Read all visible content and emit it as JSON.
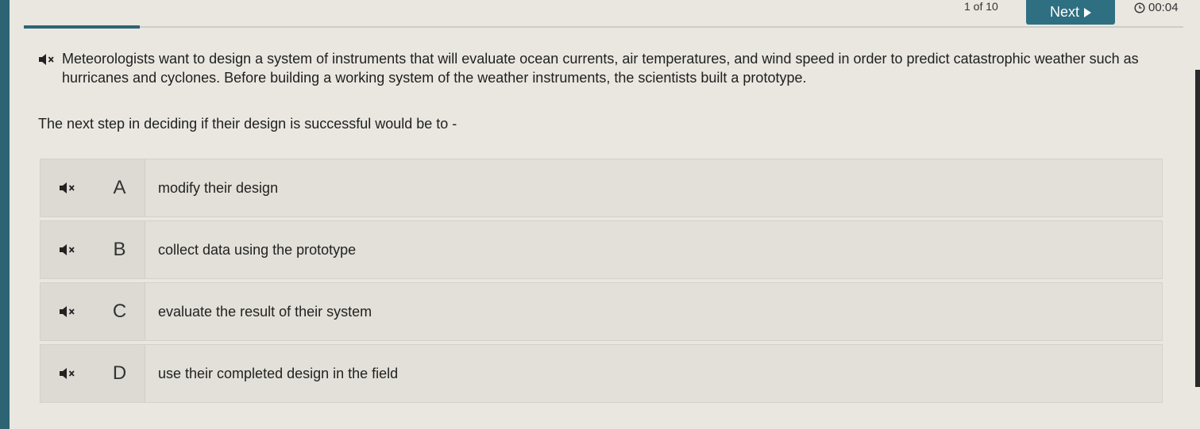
{
  "header": {
    "counter": "1 of 10",
    "next_label": "Next",
    "timer": "00:04",
    "progress_fraction": 0.1
  },
  "question": {
    "text": "Meteorologists want to design a system of instruments that will evaluate ocean currents, air temperatures, and wind speed in order to predict catastrophic weather such as hurricanes and cyclones. Before building a working system of the weather instruments, the scientists built a prototype.",
    "prompt": "The next step in deciding if their design is successful would be to -"
  },
  "answers": [
    {
      "letter": "A",
      "text": "modify their design"
    },
    {
      "letter": "B",
      "text": "collect data using the prototype"
    },
    {
      "letter": "C",
      "text": "evaluate the result of their system"
    },
    {
      "letter": "D",
      "text": "use their completed design in the field"
    }
  ],
  "icons": {
    "speaker": "speaker-muted-icon",
    "clock": "clock-icon",
    "next": "play-triangle-icon"
  },
  "colors": {
    "accent": "#2f6f82",
    "background": "#e9e7e0"
  }
}
